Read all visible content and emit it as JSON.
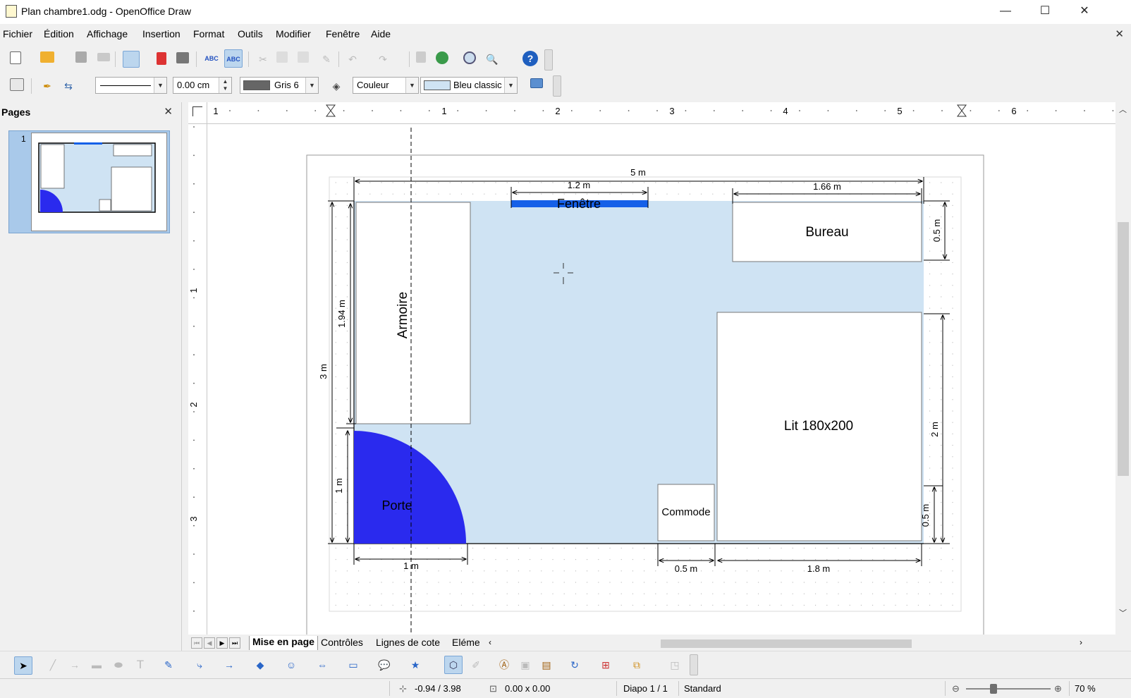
{
  "window": {
    "title": "Plan chambre1.odg - OpenOffice Draw",
    "minimize_glyph": "—",
    "maximize_glyph": "☐",
    "close_glyph": "✕"
  },
  "menu": {
    "items": [
      "Fichier",
      "Édition",
      "Affichage",
      "Insertion",
      "Format",
      "Outils",
      "Modifier",
      "Fenêtre",
      "Aide"
    ],
    "close_glyph": "✕"
  },
  "toolbar2": {
    "line_width": "0.00 cm",
    "line_color_name": "Gris 6",
    "area_style": "Couleur",
    "area_color_name": "Bleu classic",
    "line_color_hex": "#666666",
    "area_color_hex": "#cfe3f3"
  },
  "pages_pane": {
    "title": "Pages",
    "close_glyph": "✕",
    "thumb_number": "1"
  },
  "rulers": {
    "h_labels": [
      "1",
      "1",
      "2",
      "3",
      "4",
      "5",
      "6"
    ],
    "v_labels": [
      "1",
      "2",
      "3"
    ]
  },
  "drawing": {
    "room_width": "5 m",
    "window_width": "1.2 m",
    "window_label": "Fenêtre",
    "desk_width": "1.66 m",
    "desk_label": "Bureau",
    "desk_depth": "0.5 m",
    "wardrobe_label": "Armoire",
    "wardrobe_height": "1.94 m",
    "room_height": "3 m",
    "door_height": "1 m",
    "door_label": "Porte",
    "door_width": "1 m",
    "bed_label": "Lit 180x200",
    "bed_length": "2 m",
    "bed_offset": "0.5 m",
    "dresser_label": "Commode",
    "dresser_width": "0.5 m",
    "bed_width": "1.8 m",
    "floor_color": "#cfe3f3",
    "door_color": "#2a2aee",
    "window_color": "#1560e8"
  },
  "tabs": {
    "items": [
      "Mise en page",
      "Contrôles",
      "Lignes de cote",
      "Eléme"
    ],
    "active": "Mise en page"
  },
  "status": {
    "position": "-0.94 / 3.98",
    "size": "0.00 x 0.00",
    "slide": "Diapo 1 / 1",
    "master": "Standard",
    "zoom": "70 %"
  }
}
